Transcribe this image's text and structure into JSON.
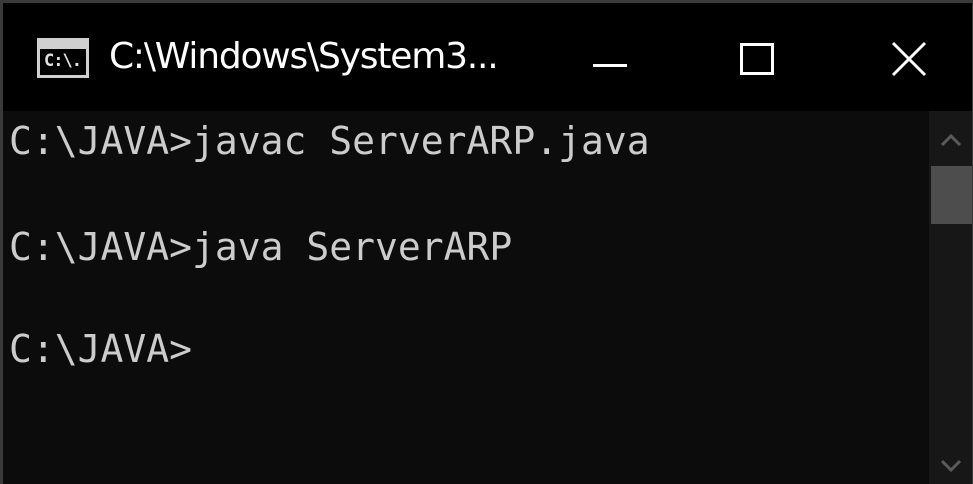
{
  "window": {
    "title": "C:\\Windows\\System3...",
    "app_icon_text": "C:\\."
  },
  "console": {
    "lines": [
      "C:\\JAVA>javac ServerARP.java",
      "C:\\JAVA>java ServerARP",
      "C:\\JAVA>"
    ]
  },
  "icons": {
    "app": "cmd-icon",
    "minimize": "minimize-icon",
    "maximize": "maximize-icon",
    "close": "close-icon",
    "scroll_up": "chevron-up-icon",
    "scroll_down": "chevron-down-icon"
  },
  "colors": {
    "titlebar": "#000000",
    "console_bg": "#0c0c0c",
    "console_text": "#cccccc",
    "scrollbar_track": "#171717",
    "scrollbar_thumb": "#4d4d4d"
  }
}
